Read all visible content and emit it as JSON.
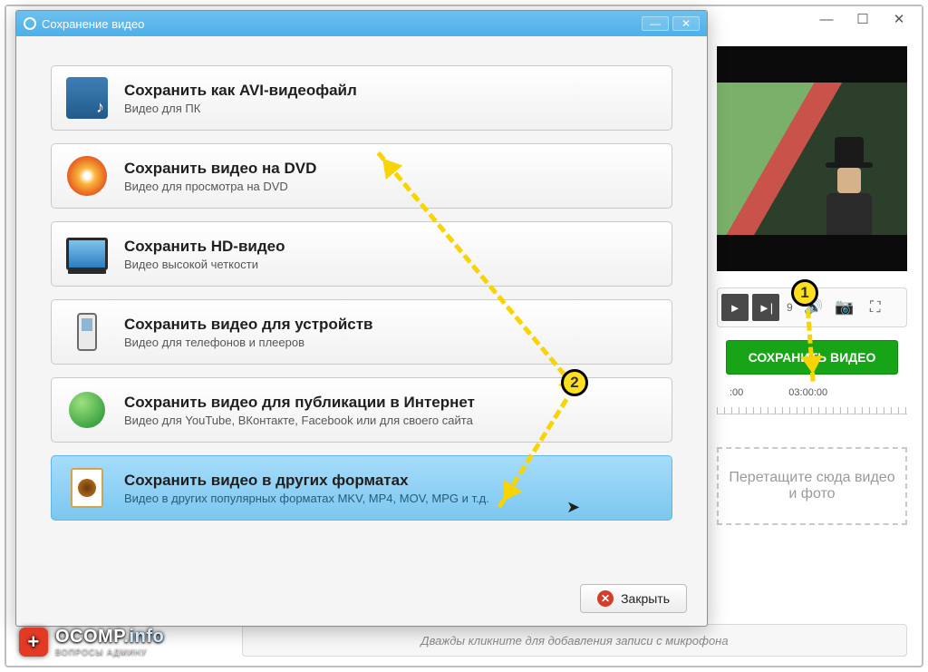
{
  "app_window": {
    "min_tip": "Minimize",
    "max_tip": "Maximize",
    "close_tip": "Close"
  },
  "dialog": {
    "title": "Сохранение видео",
    "options": [
      {
        "title": "Сохранить как AVI-видеофайл",
        "subtitle": "Видео для ПК"
      },
      {
        "title": "Сохранить видео на DVD",
        "subtitle": "Видео для просмотра на DVD"
      },
      {
        "title": "Сохранить HD-видео",
        "subtitle": "Видео высокой четкости"
      },
      {
        "title": "Сохранить видео для устройств",
        "subtitle": "Видео для телефонов и плееров"
      },
      {
        "title": "Сохранить видео для публикации в Интернет",
        "subtitle": "Видео для YouTube, ВКонтакте, Facebook или для своего сайта"
      },
      {
        "title": "Сохранить видео в других форматах",
        "subtitle": "Видео в других популярных форматах MKV, MP4, MOV, MPG и т.д."
      }
    ],
    "close_button": "Закрыть"
  },
  "preview": {
    "play_time": "9",
    "save_button": "СОХРАНИТЬ ВИДЕО",
    "ruler_labels": [
      ":00",
      "03:00:00"
    ],
    "dropzone_text": "Перетащите сюда видео и фото"
  },
  "mic_hint": "Дважды кликните для добавления записи с микрофона",
  "annotations": {
    "marker1": "1",
    "marker2": "2"
  },
  "watermark": {
    "brand": "OCOMP",
    "suffix": ".info",
    "sub": "ВОПРОСЫ АДМИНУ"
  }
}
